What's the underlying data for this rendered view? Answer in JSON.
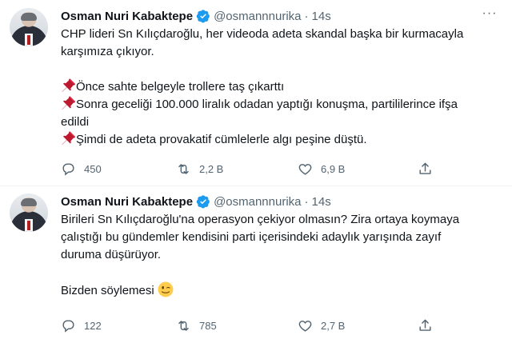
{
  "tweets": [
    {
      "author_name": "Osman Nuri Kabaktepe",
      "handle": "@osmannnurika",
      "separator": "·",
      "time": "14s",
      "more": "···",
      "lines": [
        "CHP lideri Sn Kılıçdaroğlu, her videoda adeta skandal başka bir kurmacayla",
        "karşımıza çıkıyor.",
        "",
        "Önce sahte belgeyle trollere taş çıkarttı",
        "Sonra geceliği 100.000 liralık odadan yaptığı konuşma, partililerince ifşa",
        "edildi",
        "Şimdi de adeta provakatif cümlelerle algı peşine düştü."
      ],
      "replies": "450",
      "retweets": "2,2 B",
      "likes": "6,9 B"
    },
    {
      "author_name": "Osman Nuri Kabaktepe",
      "handle": "@osmannnurika",
      "separator": "·",
      "time": "14s",
      "lines": [
        "Birileri Sn Kılıçdaroğlu'na operasyon çekiyor olmasın? Zira ortaya koymaya",
        "çalıştığı bu gündemler kendisini parti içerisindeki adaylık yarışında zayıf",
        "duruma düşürüyor.",
        "",
        "Bizden söylemesi"
      ],
      "replies": "122",
      "retweets": "785",
      "likes": "2,7 B"
    }
  ],
  "colors": {
    "text": "#0f1419",
    "muted": "#536471",
    "verified": "#1d9bf0",
    "pin": "#e0245e"
  },
  "icons": [
    "verified-badge-icon",
    "pushpin-icon",
    "reply-icon",
    "retweet-icon",
    "like-icon",
    "share-icon",
    "winking-face-icon"
  ]
}
